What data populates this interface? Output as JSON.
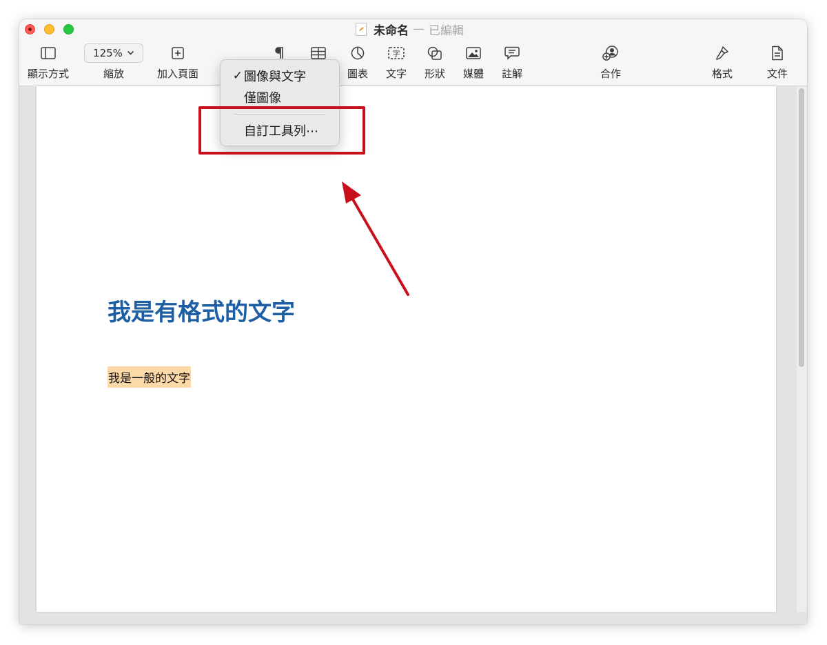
{
  "window": {
    "document_name": "未命名",
    "separator": "—",
    "document_state": "已編輯"
  },
  "toolbar": {
    "view_label": "顯示方式",
    "zoom_value": "125%",
    "zoom_label": "縮放",
    "add_page_label": "加入頁面",
    "chart_label": "圖表",
    "text_label": "文字",
    "shape_label": "形狀",
    "media_label": "媒體",
    "comment_label": "註解",
    "collaborate_label": "合作",
    "format_label": "格式",
    "document_label": "文件"
  },
  "context_menu": {
    "items": [
      {
        "label": "圖像與文字",
        "checked": true,
        "check_mark": "✓"
      },
      {
        "label": "僅圖像",
        "checked": false
      },
      {
        "label": "自訂工具列⋯",
        "checked": false
      }
    ]
  },
  "document": {
    "heading": "我是有格式的文字",
    "body": "我是一般的文字"
  },
  "colors": {
    "heading": "#1c5fa5",
    "highlight_bg": "#fcd9a8",
    "annotation_red": "#c8101c"
  }
}
